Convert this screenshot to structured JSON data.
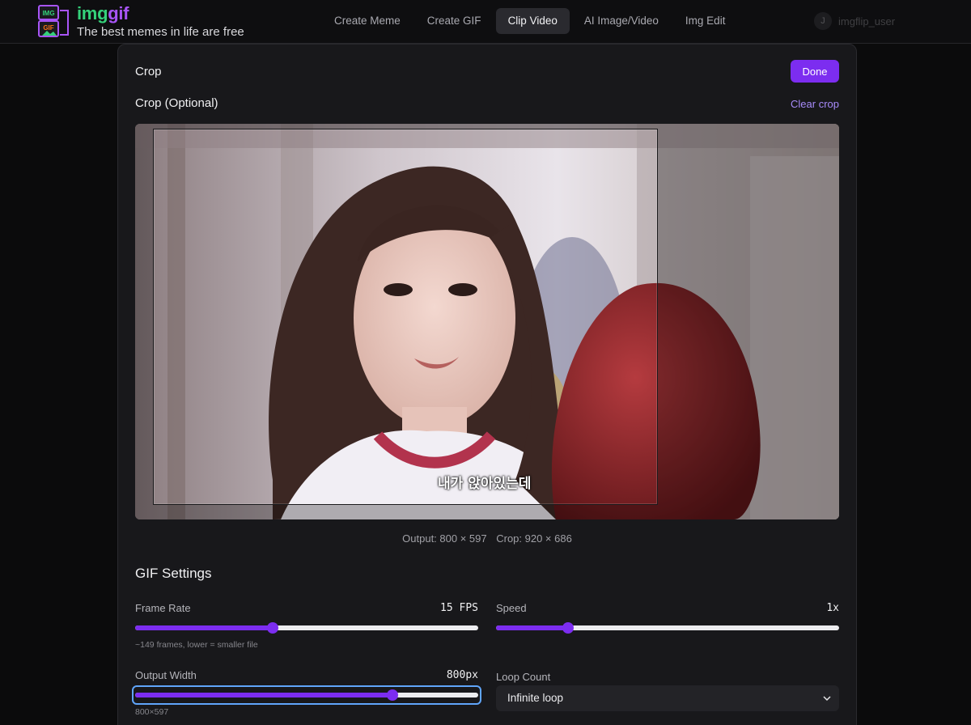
{
  "brand": {
    "name_part1": "img",
    "name_part2": "gif",
    "tagline": "The best memes in life are free",
    "logo_text_top": "IMG",
    "logo_text_bottom": "GIF",
    "colors": {
      "green": "#34d17a",
      "purple": "#a855f7"
    }
  },
  "nav": {
    "items": [
      {
        "label": "Create Meme",
        "active": false
      },
      {
        "label": "Create GIF",
        "active": false
      },
      {
        "label": "Clip Video",
        "active": true
      },
      {
        "label": "AI Image/Video",
        "active": false
      },
      {
        "label": "Img Edit",
        "active": false
      }
    ]
  },
  "user": {
    "initials": "J",
    "name": "imgflip_user"
  },
  "crop_panel": {
    "title": "Crop",
    "done_label": "Done",
    "section_title": "Crop (Optional)",
    "clear_label": "Clear crop",
    "subtitle_text": "내가 앉아있는데",
    "output_info": "Output: 800 × 597",
    "crop_info": "Crop: 920 × 686"
  },
  "gif_settings": {
    "title": "GIF Settings",
    "frame_rate": {
      "label": "Frame Rate",
      "value": "15 FPS",
      "level": 0.4,
      "hint": "~149 frames, lower = smaller file"
    },
    "speed": {
      "label": "Speed",
      "value": "1x",
      "level": 0.21
    },
    "output_width": {
      "label": "Output Width",
      "value": "800px",
      "level": 0.75,
      "hint": "800×597"
    },
    "loop_count": {
      "label": "Loop Count",
      "selected": "Infinite loop"
    }
  },
  "colors": {
    "accent": "#7c2df0",
    "link": "#a78bfa",
    "panel": "#18181b"
  }
}
